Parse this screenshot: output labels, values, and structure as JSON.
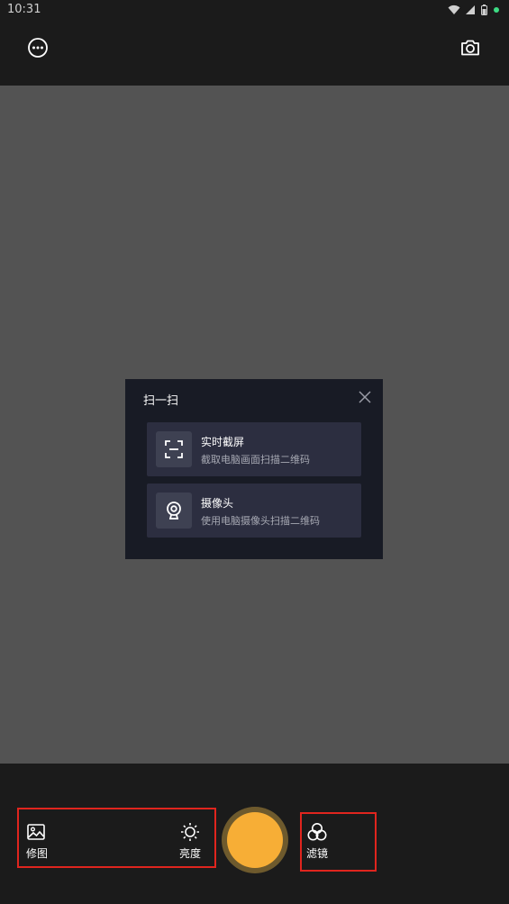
{
  "status_bar": {
    "time": "10:31"
  },
  "dialog": {
    "title": "扫一扫",
    "options": [
      {
        "icon": "scan-frame-icon",
        "title": "实时截屏",
        "desc": "截取电脑画面扫描二维码"
      },
      {
        "icon": "webcam-icon",
        "title": "摄像头",
        "desc": "使用电脑摄像头扫描二维码"
      }
    ]
  },
  "tools": {
    "edit_label": "修图",
    "brightness_label": "亮度",
    "filter_label": "滤镜"
  },
  "colors": {
    "shutter": "#f7ae36",
    "highlight": "#e0251e",
    "viewfinder": "#535353",
    "dialog_bg": "#181b25",
    "option_bg": "#2c2e40"
  }
}
